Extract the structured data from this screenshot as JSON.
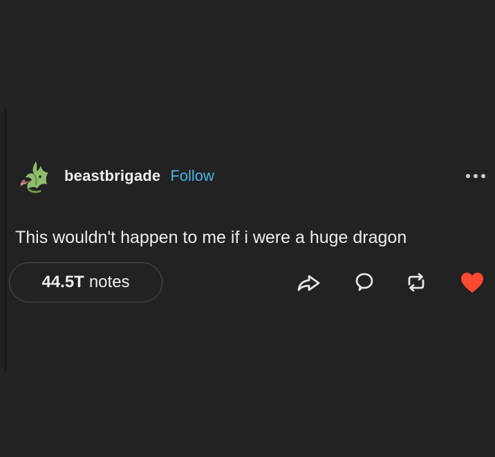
{
  "post": {
    "username": "beastbrigade",
    "follow_label": "Follow",
    "text": "This wouldn't happen to me if i were a huge dragon",
    "notes_count": "44.5T",
    "notes_label": "notes"
  },
  "icons": {
    "avatar": "avatar-image",
    "more": "more-options-icon",
    "share": "share-icon",
    "reply": "reply-icon",
    "reblog": "reblog-icon",
    "like": "heart-icon"
  },
  "colors": {
    "background": "#222223",
    "follow": "#4bb3e6",
    "like": "#ff4930",
    "text": "#ededed"
  }
}
